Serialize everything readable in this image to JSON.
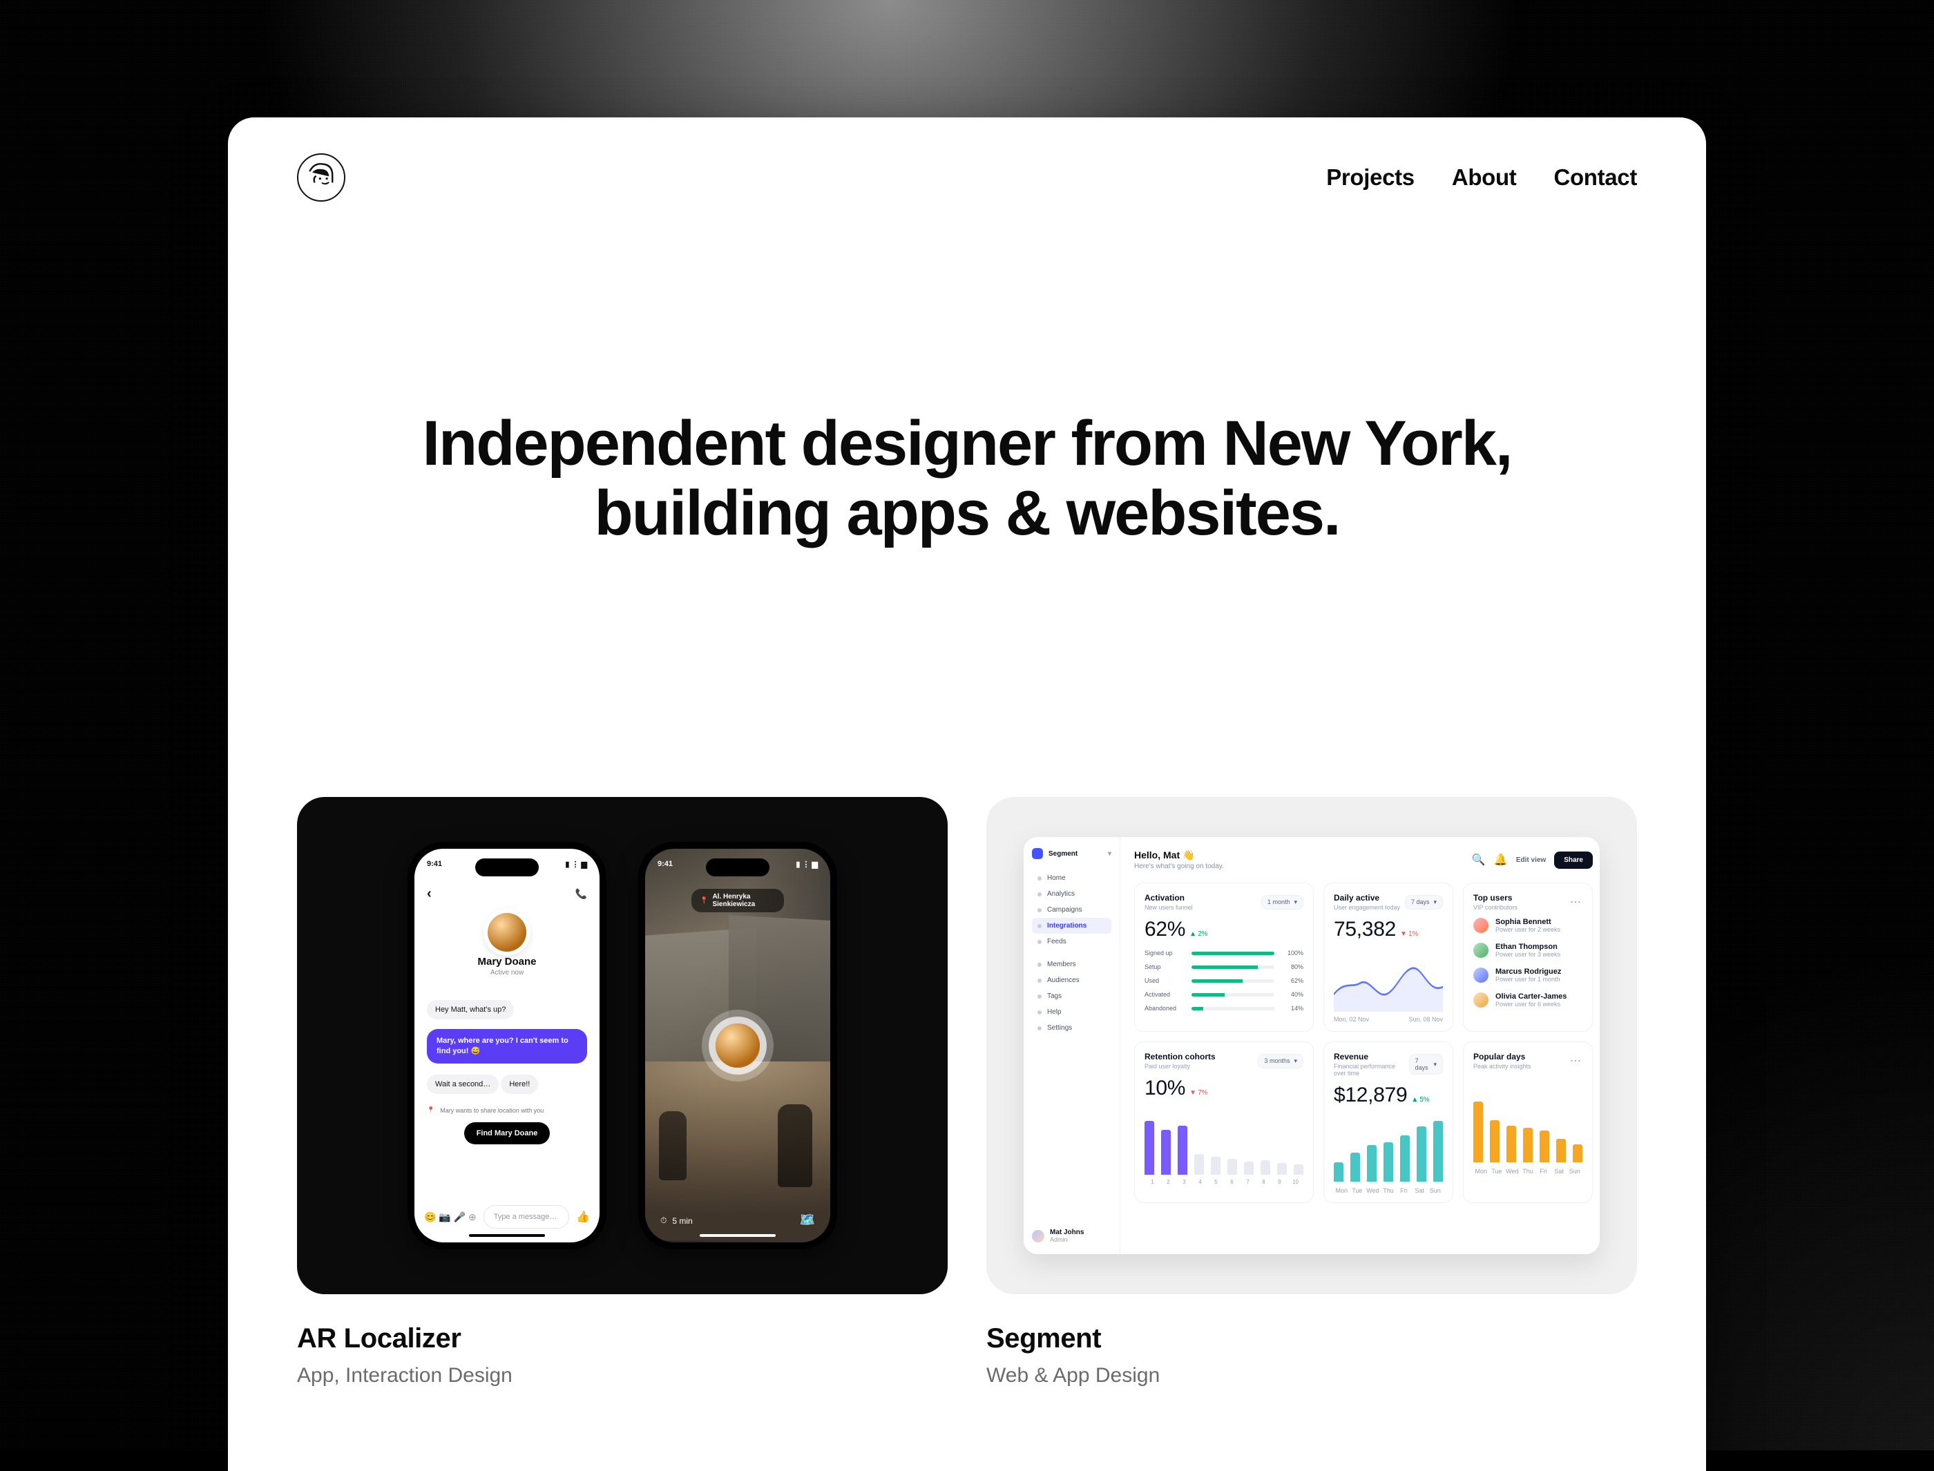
{
  "nav": {
    "projects": "Projects",
    "about": "About",
    "contact": "Contact"
  },
  "hero": {
    "line1": "Independent designer from New York,",
    "line2": "building apps & websites."
  },
  "projects": [
    {
      "title": "AR Localizer",
      "subtitle": "App, Interaction Design"
    },
    {
      "title": "Segment",
      "subtitle": "Web & App Design"
    }
  ],
  "ar": {
    "time": "9:41",
    "address": "Al. Henryka Sienkiewicza",
    "person": "Mary Doane",
    "status": "Active now",
    "greeting": "Hey Matt, what's up?",
    "purple": "Mary, where are you? I can't seem to find you! 😅",
    "wait": "Wait a second…",
    "here": "Here!!",
    "share_line": "Mary wants to share location with you",
    "cta": "Find Mary Doane",
    "placeholder": "Type a message…",
    "duration": "5 min"
  },
  "segment": {
    "brand": "Segment",
    "sidebar": [
      "Home",
      "Analytics",
      "Campaigns",
      "Integrations",
      "Feeds",
      "Members",
      "Audiences",
      "Tags",
      "Help",
      "Settings"
    ],
    "sidebar_user": {
      "name": "Mat Johns",
      "role": "Admin"
    },
    "hello": "Hello, Mat 👋",
    "hello_sub": "Here's what's going on today.",
    "editview": "Edit view",
    "share": "Share",
    "cards": {
      "activation": {
        "title": "Activation",
        "sub": "New users funnel",
        "range": "1 month",
        "value": "62%",
        "trend": "▲ 2%",
        "rows": [
          {
            "label": "Signed up",
            "pct": 100
          },
          {
            "label": "Setup",
            "pct": 80
          },
          {
            "label": "Used",
            "pct": 62
          },
          {
            "label": "Activated",
            "pct": 40
          },
          {
            "label": "Abandoned",
            "pct": 14
          }
        ]
      },
      "daily": {
        "title": "Daily active",
        "sub": "User engagement today",
        "range": "7 days",
        "value": "75,382",
        "trend": "▼ 1%",
        "xleft": "Mon, 02 Nov",
        "xright": "Sun, 08 Nov"
      },
      "top": {
        "title": "Top users",
        "sub": "VIP contributors",
        "users": [
          {
            "name": "Sophia Bennett",
            "sub": "Power user for 2 weeks"
          },
          {
            "name": "Ethan Thompson",
            "sub": "Power user for 3 weeks"
          },
          {
            "name": "Marcus Rodriguez",
            "sub": "Power user for 1 month"
          },
          {
            "name": "Olivia Carter-James",
            "sub": "Power user for 6 weeks"
          }
        ]
      },
      "retention": {
        "title": "Retention cohorts",
        "sub": "Paid user loyalty",
        "range": "3 months",
        "value": "10%",
        "trend": "▼ 7%",
        "heights": [
          82,
          68,
          74,
          32,
          28,
          24,
          20,
          22,
          18,
          16
        ],
        "ghost_after": 3,
        "x": [
          "1",
          "2",
          "3",
          "4",
          "5",
          "6",
          "7",
          "8",
          "9",
          "10"
        ]
      },
      "revenue": {
        "title": "Revenue",
        "sub": "Financial performance over time",
        "range": "7 days",
        "value": "$12,879",
        "trend": "▲ 5%",
        "heights": [
          30,
          44,
          56,
          60,
          70,
          84,
          92
        ],
        "days": [
          "Mon",
          "Tue",
          "Wed",
          "Thu",
          "Fri",
          "Sat",
          "Sun"
        ]
      },
      "popular": {
        "title": "Popular days",
        "sub": "Peak activity insights",
        "heights": [
          92,
          64,
          56,
          52,
          48,
          36,
          28
        ],
        "days": [
          "Mon",
          "Tue",
          "Wed",
          "Thu",
          "Fri",
          "Sat",
          "Sun"
        ]
      }
    }
  }
}
